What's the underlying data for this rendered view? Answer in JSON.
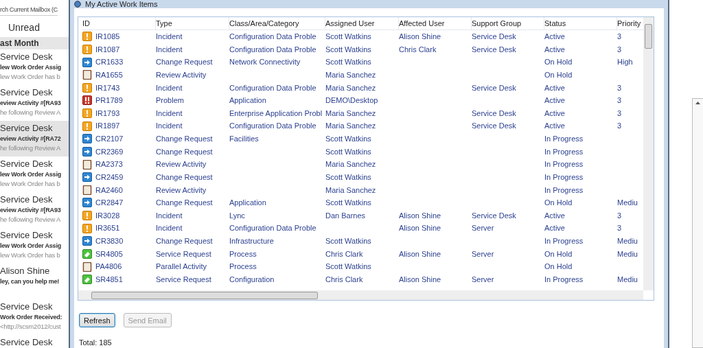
{
  "outlook": {
    "search_text": "rch Current Mailbox (C",
    "filter_label": "Unread",
    "group_header": "ast Month",
    "messages": [
      {
        "sender": "Service Desk",
        "subject": "lew Work Order Assig",
        "preview": "lew Work Order has b",
        "selected": false
      },
      {
        "sender": "Service Desk",
        "subject": "eview Activity #[RA93",
        "preview": "he following Review A",
        "selected": false
      },
      {
        "sender": "Service Desk",
        "subject": "eview Activity #[RA72",
        "preview": "he following Review A",
        "selected": true
      },
      {
        "sender": "Service Desk",
        "subject": "lew Work Order Assig",
        "preview": "lew Work Order has b",
        "selected": false
      },
      {
        "sender": "Service Desk",
        "subject": "eview Activity #[RA93",
        "preview": "he following Review A",
        "selected": false
      },
      {
        "sender": "Service Desk",
        "subject": "lew Work Order Assig",
        "preview": "lew Work Order has b",
        "selected": false
      },
      {
        "sender": "Alison Shine",
        "subject": "ley, can you help me!",
        "selected": false
      },
      {
        "sender": "Service Desk",
        "subject": "Work Order Received:",
        "preview": "<http://scsm2012/cust",
        "selected": false
      },
      {
        "sender": "Service Desk",
        "selected": false
      }
    ]
  },
  "dialog": {
    "title": "My Active Work Items",
    "table": {
      "columns": [
        "ID",
        "Type",
        "Class/Area/Category",
        "Assigned User",
        "Affected User",
        "Support Group",
        "Status",
        "Priority"
      ],
      "rows": [
        {
          "kind": "incident",
          "cells": [
            "IR1085",
            "Incident",
            "Configuration Data Proble",
            "Scott Watkins",
            "Alison Shine",
            "Service Desk",
            "Active",
            "3"
          ]
        },
        {
          "kind": "incident",
          "cells": [
            "IR1087",
            "Incident",
            "Configuration Data Proble",
            "Scott Watkins",
            "Chris Clark",
            "Service Desk",
            "Active",
            "3"
          ]
        },
        {
          "kind": "change",
          "cells": [
            "CR1633",
            "Change Request",
            "Network Connectivity",
            "Scott Watkins",
            "",
            "",
            "On Hold",
            "High"
          ]
        },
        {
          "kind": "review",
          "cells": [
            "RA1655",
            "Review Activity",
            "",
            "Maria Sanchez",
            "",
            "",
            "On Hold",
            ""
          ]
        },
        {
          "kind": "incident",
          "cells": [
            "IR1743",
            "Incident",
            "Configuration Data Proble",
            "Maria Sanchez",
            "",
            "Service Desk",
            "Active",
            "3"
          ]
        },
        {
          "kind": "problem",
          "cells": [
            "PR1789",
            "Problem",
            "Application",
            "DEMO\\Desktop",
            "",
            "",
            "Active",
            "3"
          ]
        },
        {
          "kind": "incident",
          "cells": [
            "IR1793",
            "Incident",
            "Enterprise Application Probl",
            "Maria Sanchez",
            "",
            "Service Desk",
            "Active",
            "3"
          ]
        },
        {
          "kind": "incident",
          "cells": [
            "IR1897",
            "Incident",
            "Configuration Data Proble",
            "Maria Sanchez",
            "",
            "Service Desk",
            "Active",
            "3"
          ]
        },
        {
          "kind": "change",
          "cells": [
            "CR2107",
            "Change Request",
            "Facilities",
            "Scott Watkins",
            "",
            "",
            "In Progress",
            ""
          ]
        },
        {
          "kind": "change",
          "cells": [
            "CR2369",
            "Change Request",
            "",
            "Scott Watkins",
            "",
            "",
            "In Progress",
            ""
          ]
        },
        {
          "kind": "review",
          "cells": [
            "RA2373",
            "Review Activity",
            "",
            "Maria Sanchez",
            "",
            "",
            "In Progress",
            ""
          ]
        },
        {
          "kind": "change",
          "cells": [
            "CR2459",
            "Change Request",
            "",
            "Scott Watkins",
            "",
            "",
            "In Progress",
            ""
          ]
        },
        {
          "kind": "review",
          "cells": [
            "RA2460",
            "Review Activity",
            "",
            "Maria Sanchez",
            "",
            "",
            "In Progress",
            ""
          ]
        },
        {
          "kind": "change",
          "cells": [
            "CR2847",
            "Change Request",
            "Application",
            "Scott Watkins",
            "",
            "",
            "On Hold",
            "Mediu"
          ]
        },
        {
          "kind": "incident",
          "cells": [
            "IR3028",
            "Incident",
            "Lync",
            "Dan Barnes",
            "Alison Shine",
            "Service Desk",
            "Active",
            "3"
          ]
        },
        {
          "kind": "incident",
          "cells": [
            "IR3651",
            "Incident",
            "Configuration Data Proble",
            "",
            "Alison Shine",
            "Server",
            "Active",
            "3"
          ]
        },
        {
          "kind": "change",
          "cells": [
            "CR3830",
            "Change Request",
            "Infrastructure",
            "Scott Watkins",
            "",
            "",
            "In Progress",
            "Mediu"
          ]
        },
        {
          "kind": "service",
          "cells": [
            "SR4805",
            "Service Request",
            "Process",
            "Chris Clark",
            "Alison Shine",
            "Server",
            "On Hold",
            "Mediu"
          ]
        },
        {
          "kind": "review",
          "cells": [
            "PA4806",
            "Parallel Activity",
            "Process",
            "Scott Watkins",
            "",
            "",
            "On Hold",
            ""
          ]
        },
        {
          "kind": "service",
          "cells": [
            "SR4851",
            "Service Request",
            "Configuration",
            "Chris Clark",
            "Alison Shine",
            "Server",
            "In Progress",
            "Mediu"
          ]
        }
      ]
    },
    "buttons": [
      {
        "label": "Refresh",
        "disabled": false,
        "focused": true
      },
      {
        "label": "Send Email",
        "disabled": true,
        "focused": false
      }
    ],
    "total": "Total: 185"
  }
}
